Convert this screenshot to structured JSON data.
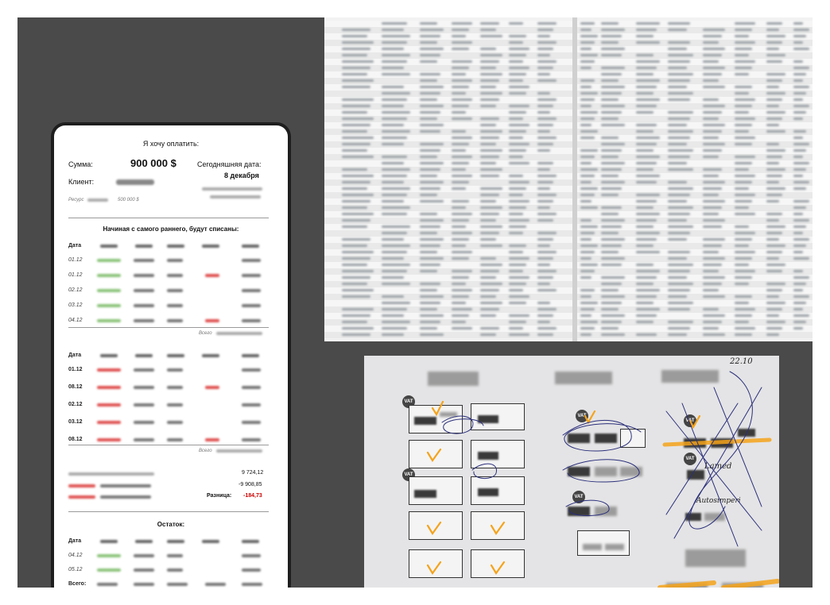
{
  "phone": {
    "header": "Я хочу оплатить:",
    "sum_label": "Сумма:",
    "sum_value": "900 000 $",
    "date_label": "Сегодняшняя дата:",
    "date_value": "8 декабря",
    "client_label": "Клиент:",
    "resource_label": "Ресурс",
    "resource_value": "500 000 $",
    "section1_title": "Начиная с самого раннего, будут списаны:",
    "table1": {
      "col_date": "Дата",
      "rows": [
        {
          "date": "01.12",
          "flag": false
        },
        {
          "date": "01.12",
          "flag": true
        },
        {
          "date": "02.12",
          "flag": false
        },
        {
          "date": "03.12",
          "flag": false
        },
        {
          "date": "04.12",
          "flag": true
        }
      ],
      "total": "Всего"
    },
    "table2": {
      "col_date": "Дата",
      "rows": [
        {
          "date": "01.12",
          "flag": false
        },
        {
          "date": "08.12",
          "flag": true
        },
        {
          "date": "02.12",
          "flag": false
        },
        {
          "date": "03.12",
          "flag": false
        },
        {
          "date": "08.12",
          "flag": true
        }
      ],
      "total": "Всего"
    },
    "summary": {
      "value1": "9 724,12",
      "value2": "-9 908,85",
      "diff_label": "Разница:",
      "diff_value": "-184,73"
    },
    "section2_title": "Остаток:",
    "table3": {
      "col_date": "Дата",
      "rows": [
        {
          "date": "04.12"
        },
        {
          "date": "05.12"
        }
      ],
      "total": "Всего:"
    }
  },
  "paper": {
    "vat_badge": "VAT",
    "hand_note_1": "Lamed",
    "hand_note_2": "Autosimperi",
    "hand_date": "22.10"
  },
  "colors": {
    "stage": "#4a4a4a",
    "green_blur": "#8cc47a",
    "red_blur": "#e05050",
    "diff_red": "#cc0000",
    "orange_mark": "#f5a31a",
    "ink": "#2b2f7a"
  }
}
